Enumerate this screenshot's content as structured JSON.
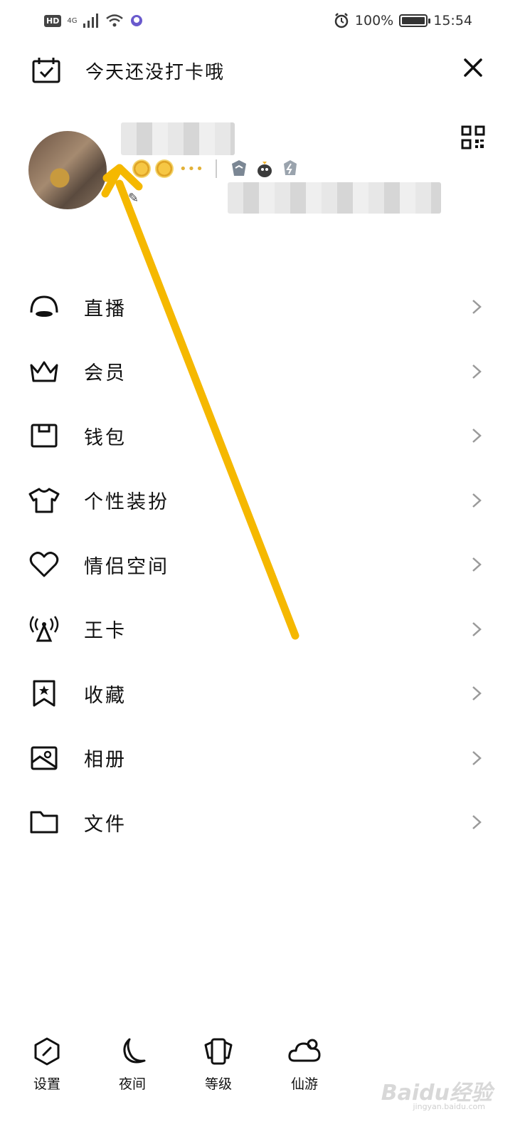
{
  "status_bar": {
    "hd": "HD",
    "network": "4G",
    "battery_percent": "100%",
    "battery_level": 1.0,
    "time": "15:54"
  },
  "header": {
    "checkin_text": "今天还没打卡哦"
  },
  "menu": {
    "items": [
      {
        "label": "直播",
        "icon": "live-icon"
      },
      {
        "label": "会员",
        "icon": "crown-icon"
      },
      {
        "label": "钱包",
        "icon": "wallet-icon"
      },
      {
        "label": "个性装扮",
        "icon": "tshirt-icon"
      },
      {
        "label": "情侣空间",
        "icon": "heart-icon"
      },
      {
        "label": "王卡",
        "icon": "signal-tower-icon"
      },
      {
        "label": "收藏",
        "icon": "bookmark-star-icon"
      },
      {
        "label": "相册",
        "icon": "photo-album-icon"
      },
      {
        "label": "文件",
        "icon": "folder-icon"
      }
    ]
  },
  "bottom_bar": {
    "tabs": [
      {
        "label": "设置",
        "icon": "settings-icon"
      },
      {
        "label": "夜间",
        "icon": "moon-icon"
      },
      {
        "label": "等级",
        "icon": "level-icon"
      },
      {
        "label": "仙游",
        "icon": "cloud-icon"
      }
    ]
  },
  "watermark": {
    "text": "Baidu经验",
    "sub": "jingyan.baidu.com"
  },
  "colors": {
    "arrow": "#f5b800",
    "text": "#111111",
    "chevron": "#9a9a9a"
  }
}
